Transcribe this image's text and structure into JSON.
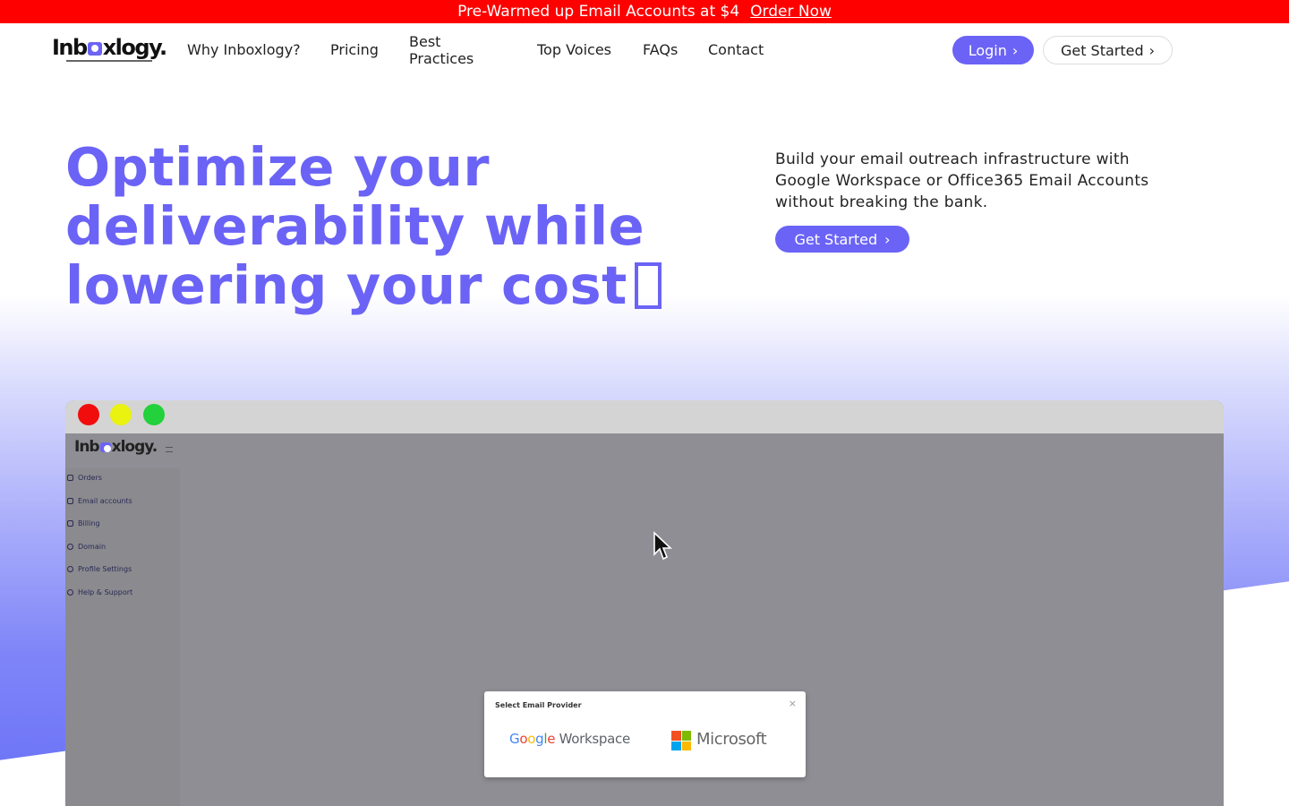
{
  "announcement": {
    "text": "Pre-Warmed up Email Accounts at $4",
    "link": "Order Now"
  },
  "nav": {
    "logo": {
      "word_prefix": "Inb",
      "word_suffix": "xlogy."
    },
    "links": [
      "Why Inboxlogy?",
      "Pricing",
      "Best Practices",
      "Top Voices",
      "FAQs",
      "Contact"
    ],
    "login": "Login",
    "get_started": "Get Started",
    "chevron": "›"
  },
  "hero": {
    "headline": "Optimize your deliverability while lowering your cost",
    "description": "Build your email outreach infrastructure with Google Workspace or Office365 Email Accounts without breaking the bank.",
    "cta": "Get Started",
    "cta_chevron": "›"
  },
  "app_preview": {
    "logo": {
      "word_prefix": "Inb",
      "word_suffix": "xlogy."
    },
    "sidebar": [
      "Orders",
      "Email accounts",
      "Billing",
      "Domain",
      "Profile Settings",
      "Help & Support"
    ],
    "modal": {
      "title": "Select Email Provider",
      "close": "×",
      "google_letters": [
        "G",
        "o",
        "o",
        "g",
        "l",
        "e"
      ],
      "google_product": "Workspace",
      "microsoft": "Microsoft"
    }
  },
  "colors": {
    "brand": "#6b63f6",
    "announcement_bg": "#ff0000",
    "google_blue": "#4285f4",
    "google_red": "#ea4335",
    "google_yellow": "#fbbc05",
    "google_green": "#34a853",
    "ms_red": "#f25022",
    "ms_green": "#7fba00",
    "ms_blue": "#00a4ef",
    "ms_yellow": "#ffb900"
  },
  "icons": [
    "chevron-right-icon",
    "cursor-arrow-icon",
    "menu-icon",
    "close-icon",
    "microsoft-logo-icon"
  ]
}
